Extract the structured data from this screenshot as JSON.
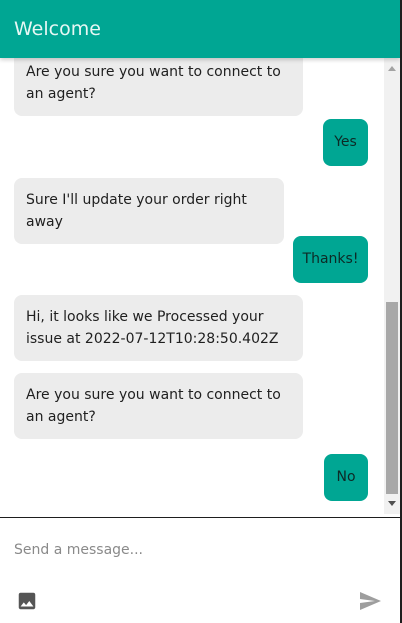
{
  "header": {
    "title": "Welcome"
  },
  "messages": [
    {
      "sender": "bot",
      "text": "Are you sure you want to connect to an agent?"
    },
    {
      "sender": "user",
      "text": "Yes"
    },
    {
      "sender": "bot",
      "text": "Sure I'll update your order right away"
    },
    {
      "sender": "user",
      "text": "Thanks!"
    },
    {
      "sender": "bot",
      "text": "Hi, it looks like we Processed your issue at 2022-07-12T10:28:50.402Z"
    },
    {
      "sender": "bot",
      "text": "Are you sure you want to connect to an agent?"
    },
    {
      "sender": "user",
      "text": "No"
    }
  ],
  "composer": {
    "placeholder": "Send a message...",
    "attach_icon": "image-icon",
    "send_icon": "send-icon"
  },
  "colors": {
    "accent": "#00a693",
    "bot_bubble": "#ececec"
  }
}
